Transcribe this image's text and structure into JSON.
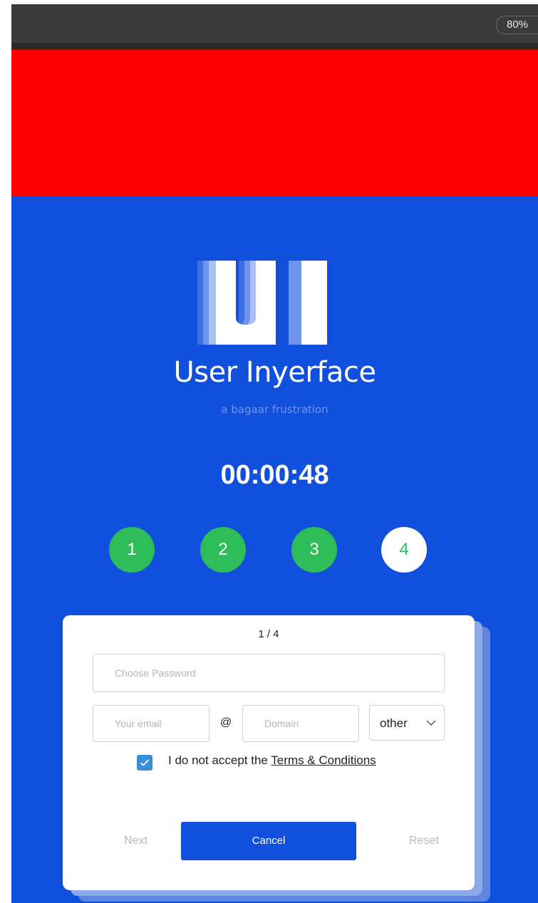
{
  "browser": {
    "zoom_label": "80%"
  },
  "brand": {
    "logo_letters": "UI",
    "name": "User Inyerface",
    "tagline": "a bagaar frustration"
  },
  "timer": "00:00:48",
  "steps": [
    {
      "label": "1",
      "status": "done"
    },
    {
      "label": "2",
      "status": "done"
    },
    {
      "label": "3",
      "status": "done"
    },
    {
      "label": "4",
      "status": "current"
    }
  ],
  "form": {
    "page_indicator": "1 / 4",
    "password_placeholder": "Choose Password",
    "email_placeholder": "Your email",
    "at_symbol": "@",
    "domain_placeholder": "Domain",
    "tld_selected": "other",
    "terms_prefix": "I do not accept the ",
    "terms_link": "Terms & Conditions",
    "terms_checked": true,
    "next_label": "Next",
    "cancel_label": "Cancel",
    "reset_label": "Reset"
  },
  "colors": {
    "background_blue": "#1150dd",
    "banner_red": "#ff0000",
    "step_green": "#2ebd59",
    "checkbox_blue": "#3a8ed8"
  }
}
